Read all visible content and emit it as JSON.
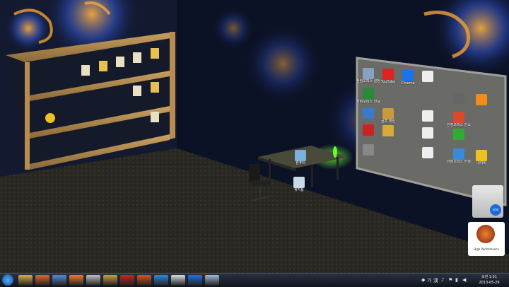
{
  "screen_icons": [
    {
      "label": "한컴오피스 설정",
      "icon": "hancom-settings-icon",
      "color": "#8aa0c0"
    },
    {
      "label": "YouTube",
      "icon": "youtube-icon",
      "color": "#d22"
    },
    {
      "label": "Chrome",
      "icon": "chrome-icon",
      "color": "#1a73e8"
    },
    {
      "label": "",
      "icon": "document-icon",
      "color": "#eee"
    },
    {
      "label": "한컴오피스 한글 2010",
      "icon": "hwp-icon",
      "color": "#2a8a3a"
    },
    {
      "label": "",
      "icon": "app-icon",
      "color": "#666"
    },
    {
      "label": "",
      "icon": "orange-app-icon",
      "color": "#f28c1a"
    },
    {
      "label": "",
      "icon": "blue-app-icon",
      "color": "#3a7ac8"
    },
    {
      "label": "골프 게임",
      "icon": "game-icon",
      "color": "#c89a3a"
    },
    {
      "label": "",
      "icon": "document-icon",
      "color": "#eee"
    },
    {
      "label": "한컴오피스 한쇼",
      "icon": "hanshow-icon",
      "color": "#d84a2a"
    },
    {
      "label": "",
      "icon": "red-app-icon",
      "color": "#c22"
    },
    {
      "label": "",
      "icon": "gold-app-icon",
      "color": "#d8a83a"
    },
    {
      "label": "",
      "icon": "document-icon",
      "color": "#eee"
    },
    {
      "label": "",
      "icon": "green-app-icon",
      "color": "#3a3"
    },
    {
      "label": "",
      "icon": "disk-icon",
      "color": "#888"
    },
    {
      "label": "",
      "icon": "document-icon",
      "color": "#eee"
    },
    {
      "label": "한컴오피스 한셀 2010",
      "icon": "hancell-icon",
      "color": "#3a8ad8"
    },
    {
      "label": "네이버",
      "icon": "naver-icon",
      "color": "#f0c020"
    }
  ],
  "desk_icons": [
    {
      "label": "컴퓨터",
      "icon": "computer-icon"
    },
    {
      "label": "휴지통",
      "icon": "recycle-bin-icon"
    }
  ],
  "gadgets": {
    "cpu_label": "Intel",
    "performance_label": "High Performance"
  },
  "taskbar": {
    "start_icon": "windows-start-icon",
    "apps": [
      {
        "icon": "folder-icon",
        "color": "#d8b040"
      },
      {
        "icon": "media-player-icon",
        "color": "#e06a2a"
      },
      {
        "icon": "network-icon",
        "color": "#5a8ad8"
      },
      {
        "icon": "alsong-icon",
        "color": "#f08020"
      },
      {
        "icon": "antivirus-icon",
        "color": "#c0c0c0"
      },
      {
        "icon": "game-icon",
        "color": "#caa040"
      },
      {
        "icon": "red-app-icon",
        "color": "#c22"
      },
      {
        "icon": "daum-icon",
        "color": "#e05020"
      },
      {
        "icon": "internet-explorer-icon",
        "color": "#2a8ae0"
      },
      {
        "icon": "document-icon",
        "color": "#ddd"
      },
      {
        "icon": "chrome-icon",
        "color": "#1a73e8"
      },
      {
        "icon": "notepad-icon",
        "color": "#a0b8d8"
      }
    ],
    "ime": "가",
    "lang": "漢",
    "time": "오전 1:51",
    "date": "2013-05-29"
  },
  "colors": {
    "accent": "#6aff2a",
    "lamp": "#4aff3a",
    "wall": "#0e1628"
  }
}
